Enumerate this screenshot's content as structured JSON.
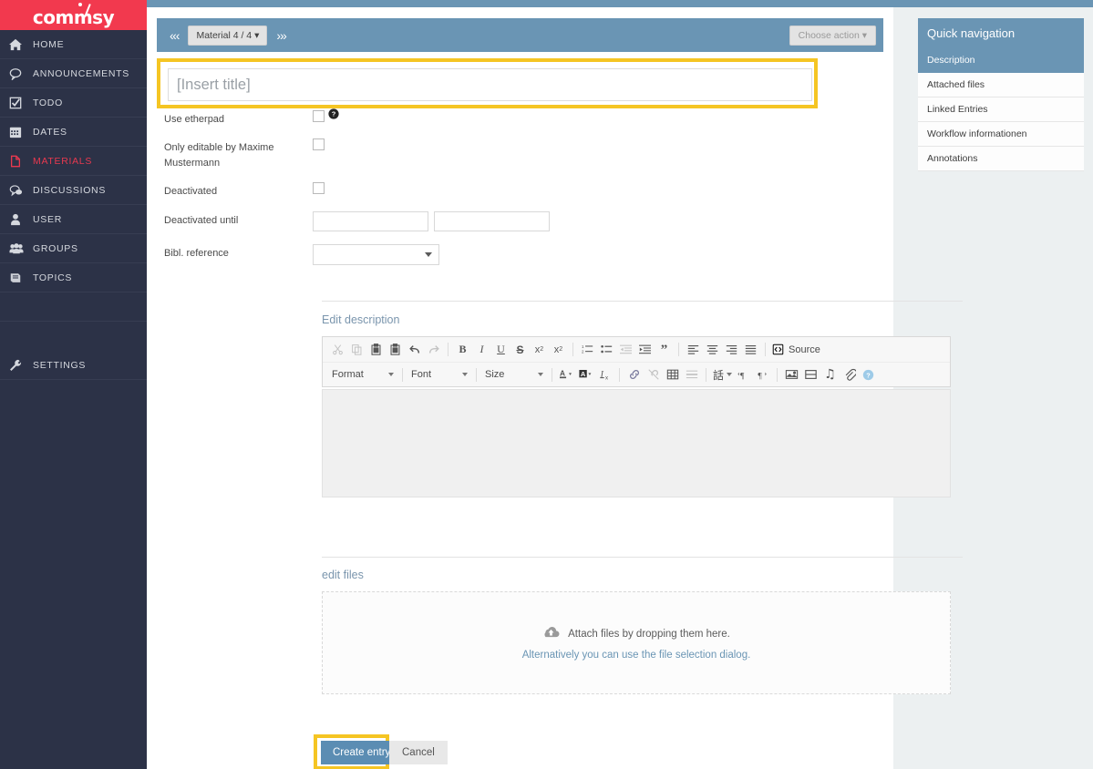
{
  "brand": {
    "name": "commsy"
  },
  "sidebar": {
    "items": [
      {
        "label": "HOME",
        "icon": "home-icon",
        "active": false
      },
      {
        "label": "ANNOUNCEMENTS",
        "icon": "speech-bubble-icon",
        "active": false
      },
      {
        "label": "TODO",
        "icon": "check-square-icon",
        "active": false
      },
      {
        "label": "DATES",
        "icon": "calendar-icon",
        "active": false
      },
      {
        "label": "MATERIALS",
        "icon": "document-icon",
        "active": true
      },
      {
        "label": "DISCUSSIONS",
        "icon": "comments-icon",
        "active": false
      },
      {
        "label": "USER",
        "icon": "user-icon",
        "active": false
      },
      {
        "label": "GROUPS",
        "icon": "users-icon",
        "active": false
      },
      {
        "label": "TOPICS",
        "icon": "book-icon",
        "active": false
      },
      {
        "label": "SETTINGS",
        "icon": "wrench-icon",
        "active": false
      }
    ]
  },
  "toolbar": {
    "prev_arrows": "«‹",
    "next_arrows": "›»",
    "pager_label": "Material 4 / 4",
    "choose_action_label": "Choose action"
  },
  "title_field": {
    "value": "",
    "placeholder": "[Insert title]"
  },
  "form": {
    "rows": [
      {
        "label": "Use etherpad",
        "control": "checkbox",
        "checked": false,
        "has_help": true
      },
      {
        "label": "Only editable by Maxime Mustermann",
        "control": "checkbox",
        "checked": false,
        "has_help": false
      },
      {
        "label": "Deactivated",
        "control": "checkbox",
        "checked": false,
        "has_help": false
      },
      {
        "label": "Deactivated until",
        "control": "date-time",
        "value_date": "",
        "value_time": ""
      },
      {
        "label": "Bibl. reference",
        "control": "select",
        "value": ""
      }
    ]
  },
  "description": {
    "section_title": "Edit description",
    "editor_content": "",
    "toolbar_row1": [
      {
        "name": "cut-icon",
        "glyph": "✂",
        "disabled": true
      },
      {
        "name": "copy-icon",
        "glyph": "❐",
        "disabled": true
      },
      {
        "name": "paste-icon",
        "glyph": "ὌB",
        "disabled": false
      },
      {
        "name": "paste-text-icon",
        "glyph": "ὌB",
        "disabled": false
      },
      {
        "name": "undo-icon",
        "glyph": "↩",
        "disabled": false
      },
      {
        "name": "redo-icon",
        "glyph": "↪",
        "disabled": true
      },
      {
        "name": "bold-icon",
        "glyph": "B",
        "disabled": false
      },
      {
        "name": "italic-icon",
        "glyph": "I",
        "disabled": false
      },
      {
        "name": "underline-icon",
        "glyph": "U",
        "disabled": false
      },
      {
        "name": "strikethrough-icon",
        "glyph": "S",
        "disabled": false
      },
      {
        "name": "subscript-icon",
        "glyph": "x₂",
        "disabled": false
      },
      {
        "name": "superscript-icon",
        "glyph": "x²",
        "disabled": false
      },
      {
        "name": "numbered-list-icon",
        "glyph": "②",
        "disabled": false
      },
      {
        "name": "bulleted-list-icon",
        "glyph": "•",
        "disabled": false
      },
      {
        "name": "outdent-icon",
        "glyph": "⇤",
        "disabled": true
      },
      {
        "name": "indent-icon",
        "glyph": "⇥",
        "disabled": false
      },
      {
        "name": "blockquote-icon",
        "glyph": "”",
        "disabled": false
      },
      {
        "name": "align-left-icon",
        "glyph": "≡",
        "disabled": false
      },
      {
        "name": "align-center-icon",
        "glyph": "≡",
        "disabled": false
      },
      {
        "name": "align-right-icon",
        "glyph": "≡",
        "disabled": false
      },
      {
        "name": "justify-icon",
        "glyph": "≡",
        "disabled": false
      }
    ],
    "source_label": "Source",
    "format_label": "Format",
    "font_label": "Font",
    "size_label": "Size",
    "toolbar_row2": [
      {
        "name": "text-color-icon",
        "glyph": "A"
      },
      {
        "name": "background-color-icon",
        "glyph": "A"
      },
      {
        "name": "remove-format-icon",
        "glyph": "Ix"
      },
      {
        "name": "link-icon",
        "glyph": "ὑ7"
      },
      {
        "name": "unlink-icon",
        "glyph": "ὑ7"
      },
      {
        "name": "table-icon",
        "glyph": "⊞"
      },
      {
        "name": "horizontal-rule-icon",
        "glyph": "≡"
      },
      {
        "name": "language-icon",
        "glyph": "話"
      },
      {
        "name": "text-direction-ltr-icon",
        "glyph": "¶"
      },
      {
        "name": "text-direction-rtl-icon",
        "glyph": "¶"
      },
      {
        "name": "image-icon",
        "glyph": "ὛC"
      },
      {
        "name": "video-icon",
        "glyph": "▤"
      },
      {
        "name": "audio-icon",
        "glyph": "♫"
      },
      {
        "name": "attachment-icon",
        "glyph": "ὌE"
      },
      {
        "name": "about-icon",
        "glyph": "?"
      }
    ]
  },
  "files": {
    "section_title": "edit files",
    "drop_text": "Attach files by dropping them here.",
    "dialog_link": "Alternatively you can use the file selection dialog."
  },
  "actions": {
    "create_label": "Create entry",
    "cancel_label": "Cancel"
  },
  "quick_navigation": {
    "header": "Quick navigation",
    "items": [
      {
        "label": "Description",
        "selected": true
      },
      {
        "label": "Attached files",
        "selected": false
      },
      {
        "label": "Linked Entries",
        "selected": false
      },
      {
        "label": "Workflow informationen",
        "selected": false
      },
      {
        "label": "Annotations",
        "selected": false
      }
    ]
  },
  "colors": {
    "brand_red": "#f2394e",
    "sidebar_dark": "#2c3247",
    "accent_blue": "#6a95b4",
    "highlight_yellow": "#f5c523",
    "page_bg": "#ecf0f1"
  }
}
